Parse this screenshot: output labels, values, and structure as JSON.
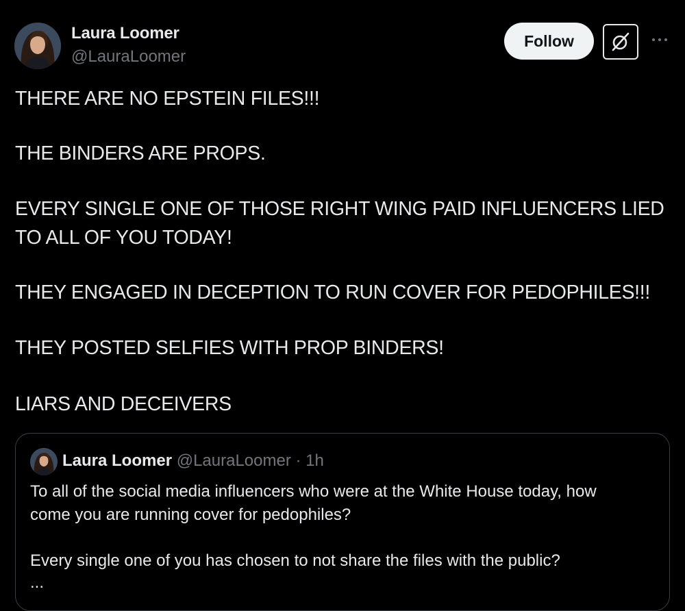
{
  "author": {
    "name": "Laura Loomer",
    "handle": "@LauraLoomer"
  },
  "actions": {
    "follow_label": "Follow",
    "grok_icon": "grok-icon",
    "more_icon": "more-icon"
  },
  "post": {
    "lines": [
      "THERE ARE NO EPSTEIN FILES!!!",
      "THE BINDERS ARE PROPS.",
      "EVERY SINGLE ONE OF THOSE RIGHT WING PAID INFLUENCERS LIED",
      "TO ALL OF YOU TODAY!",
      "THEY ENGAGED IN DECEPTION TO RUN COVER FOR PEDOPHILES!!!",
      "THEY POSTED SELFIES WITH PROP BINDERS!",
      "LIARS AND DECEIVERS"
    ]
  },
  "quote": {
    "name": "Laura Loomer",
    "handle": "@LauraLoomer",
    "dot": "·",
    "time": "1h",
    "lines": [
      "To all of the social media influencers who were at the White House today, how",
      "come you are running cover for pedophiles?",
      "Every single one of you has chosen to not share the files with the public?",
      "..."
    ]
  },
  "colors": {
    "background": "#000000",
    "text": "#e7e9ea",
    "secondary_text": "#71767b",
    "follow_bg": "#eff3f4",
    "card_border": "#3a3f44"
  }
}
